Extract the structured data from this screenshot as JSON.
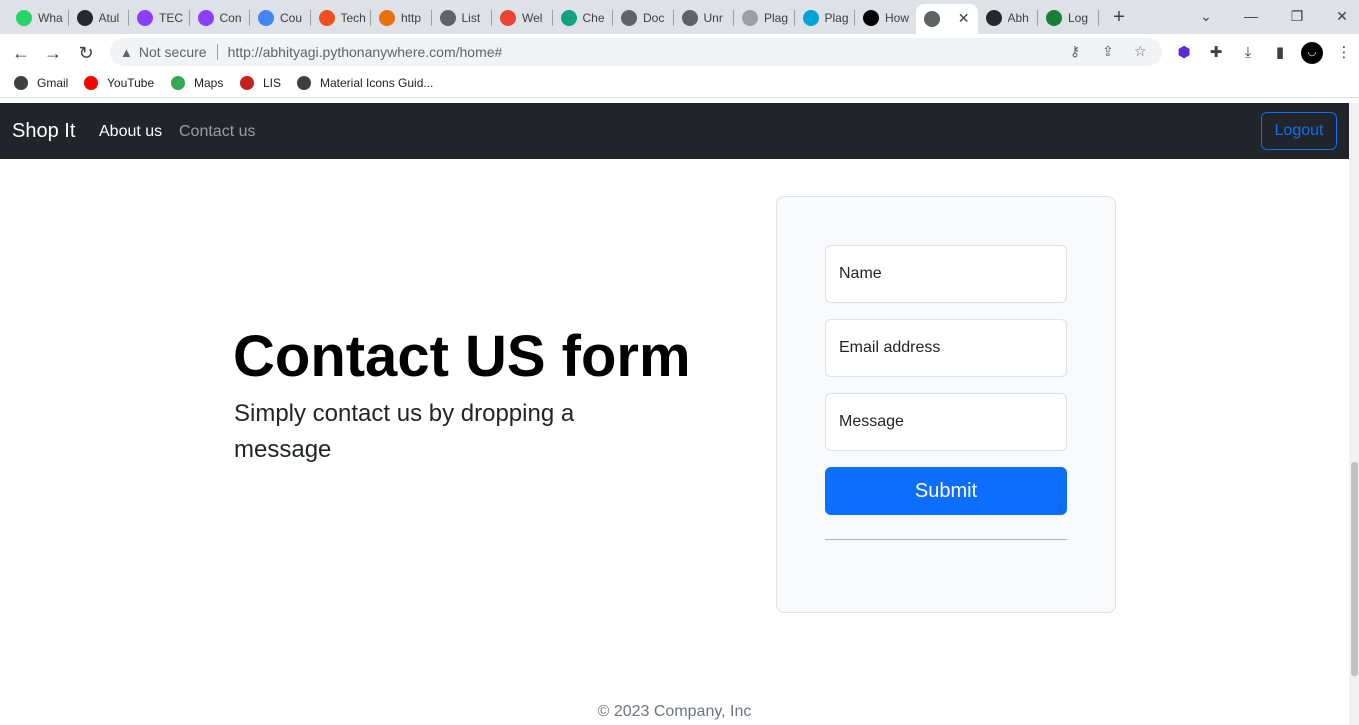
{
  "browser": {
    "tabs": [
      {
        "title": "Wha",
        "icon": "whatsapp-icon",
        "color": "#25d366"
      },
      {
        "title": "Atul",
        "icon": "github-icon",
        "color": "#24292f"
      },
      {
        "title": "TEC",
        "icon": "unstop-icon",
        "color": "#8a3ffc"
      },
      {
        "title": "Con",
        "icon": "unstop-icon",
        "color": "#8a3ffc"
      },
      {
        "title": "Cou",
        "icon": "docs-icon",
        "color": "#4285f4"
      },
      {
        "title": "Tech",
        "icon": "figma-icon",
        "color": "#f24e1e"
      },
      {
        "title": "http",
        "icon": "fn-icon",
        "color": "#e8710a"
      },
      {
        "title": "List",
        "icon": "globe-icon",
        "color": "#5f6368"
      },
      {
        "title": "Wel",
        "icon": "bookmark-icon",
        "color": "#ea4335"
      },
      {
        "title": "Che",
        "icon": "chatgpt-icon",
        "color": "#10a37f"
      },
      {
        "title": "Doc",
        "icon": "search-icon",
        "color": "#5f6368"
      },
      {
        "title": "Unr",
        "icon": "search-icon",
        "color": "#5f6368"
      },
      {
        "title": "Plag",
        "icon": "sst-icon",
        "color": "#9aa0a6"
      },
      {
        "title": "Plag",
        "icon": "c-icon",
        "color": "#00a4d6"
      },
      {
        "title": "How",
        "icon": "medium-icon",
        "color": "#000000"
      },
      {
        "title": "",
        "icon": "globe-icon",
        "color": "#5f6368",
        "active": true
      },
      {
        "title": "Abh",
        "icon": "github-icon",
        "color": "#24292f"
      },
      {
        "title": "Log",
        "icon": "link-icon",
        "color": "#188038"
      }
    ],
    "new_tab": "+",
    "window_controls": {
      "dropdown": "⌄",
      "minimize": "—",
      "restore": "❐",
      "close": "✕"
    },
    "tab_close": "✕",
    "address": {
      "security_label": "Not secure",
      "url": "http://abhityagi.pythonanywhere.com/home#"
    },
    "bookmarks": [
      {
        "label": "Gmail",
        "icon": "globe-icon",
        "color": "#3c4043"
      },
      {
        "label": "YouTube",
        "icon": "youtube-icon",
        "color": "#ff0000"
      },
      {
        "label": "Maps",
        "icon": "maps-icon",
        "color": "#34a853"
      },
      {
        "label": "LIS",
        "icon": "lis-icon",
        "color": "#c5221f"
      },
      {
        "label": "Material Icons Guid...",
        "icon": "globe-icon",
        "color": "#3c4043"
      }
    ]
  },
  "page": {
    "navbar": {
      "brand": "Shop It",
      "links": [
        {
          "label": "About us",
          "active": true
        },
        {
          "label": "Contact us",
          "active": false
        }
      ],
      "logout": "Logout"
    },
    "hero": {
      "title": "Contact US form",
      "subtitle": "Simply contact us by dropping a message"
    },
    "form": {
      "name_placeholder": "Name",
      "email_placeholder": "Email address",
      "message_placeholder": "Message",
      "submit_label": "Submit"
    },
    "footer": "© 2023 Company, Inc"
  },
  "colors": {
    "navbar_bg": "#212529",
    "primary": "#0d6efd",
    "card_bg": "#f8f9fa"
  }
}
